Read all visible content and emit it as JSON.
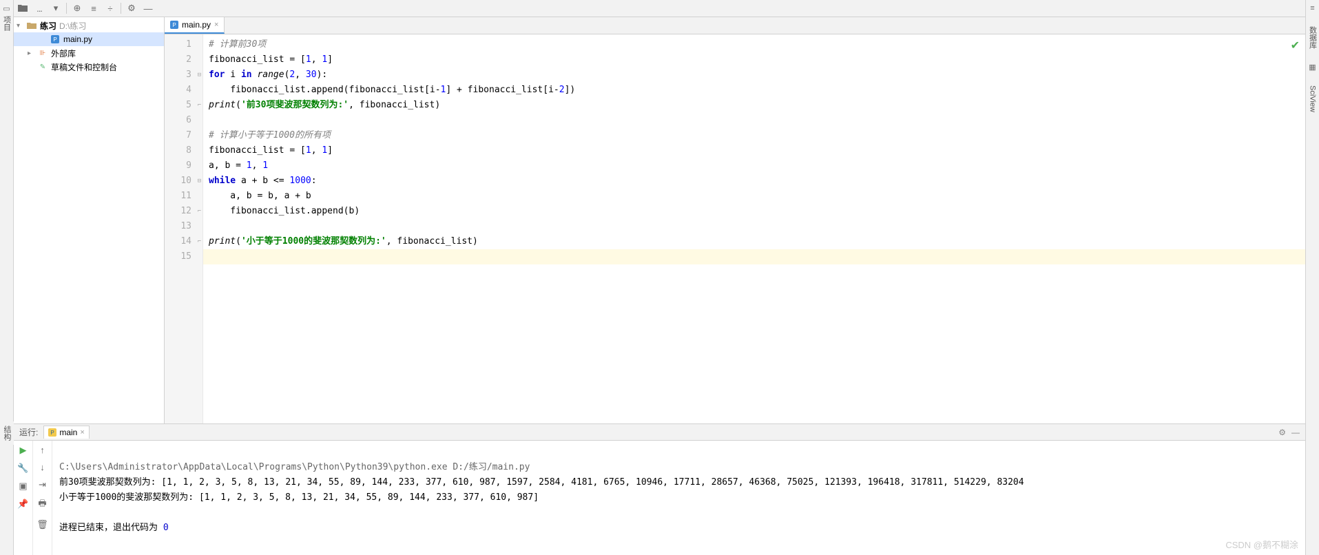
{
  "left_sidebar": {
    "label": "项目"
  },
  "right_sidebar": {
    "db_label": "数据库",
    "sciview_label": "SciView"
  },
  "toolbar": {
    "dots": "..."
  },
  "project_tree": {
    "root": {
      "name": "练习",
      "path": "D:\\练习"
    },
    "file": "main.py",
    "external_libs": "外部库",
    "scratches": "草稿文件和控制台"
  },
  "editor_tab": {
    "filename": "main.py"
  },
  "code_lines": [
    {
      "n": 1,
      "html": "<span class='com'># 计算前30项</span>"
    },
    {
      "n": 2,
      "html": "fibonacci_list = [<span class='num'>1</span>, <span class='num'>1</span>]"
    },
    {
      "n": 3,
      "html": "<span class='kw'>for</span> i <span class='kw'>in</span> <span class='fn'>range</span>(<span class='num'>2</span>, <span class='num'>30</span>):"
    },
    {
      "n": 4,
      "html": "    fibonacci_list.append(fibonacci_list[i-<span class='num'>1</span>] + fibonacci_list[i-<span class='num'>2</span>])"
    },
    {
      "n": 5,
      "html": "<span class='fn'>print</span>(<span class='str'>'前30项斐波那契数列为:'</span>, fibonacci_list)"
    },
    {
      "n": 6,
      "html": ""
    },
    {
      "n": 7,
      "html": "<span class='com'># 计算小于等于1000的所有项</span>"
    },
    {
      "n": 8,
      "html": "fibonacci_list = [<span class='num'>1</span>, <span class='num'>1</span>]"
    },
    {
      "n": 9,
      "html": "a, b = <span class='num'>1</span>, <span class='num'>1</span>"
    },
    {
      "n": 10,
      "html": "<span class='kw'>while</span> a + b &lt;= <span class='num'>1000</span>:"
    },
    {
      "n": 11,
      "html": "    a, b = b, a + b"
    },
    {
      "n": 12,
      "html": "    fibonacci_list.append(b)"
    },
    {
      "n": 13,
      "html": ""
    },
    {
      "n": 14,
      "html": "<span class='fn'>print</span>(<span class='str'>'小于等于1000的斐波那契数列为:'</span>, fibonacci_list)"
    },
    {
      "n": 15,
      "html": "",
      "current": true
    }
  ],
  "run_panel": {
    "label": "运行:",
    "config_name": "main",
    "output_path": "C:\\Users\\Administrator\\AppData\\Local\\Programs\\Python\\Python39\\python.exe D:/练习/main.py",
    "out1": "前30项斐波那契数列为: [1, 1, 2, 3, 5, 8, 13, 21, 34, 55, 89, 144, 233, 377, 610, 987, 1597, 2584, 4181, 6765, 10946, 17711, 28657, 46368, 75025, 121393, 196418, 317811, 514229, 83204",
    "out2": "小于等于1000的斐波那契数列为: [1, 1, 2, 3, 5, 8, 13, 21, 34, 55, 89, 144, 233, 377, 610, 987]",
    "exit_prefix": "进程已结束，退出代码为 ",
    "exit_code": "0"
  },
  "structure_tab": "结构",
  "watermark": "CSDN @鹅不糊涂"
}
